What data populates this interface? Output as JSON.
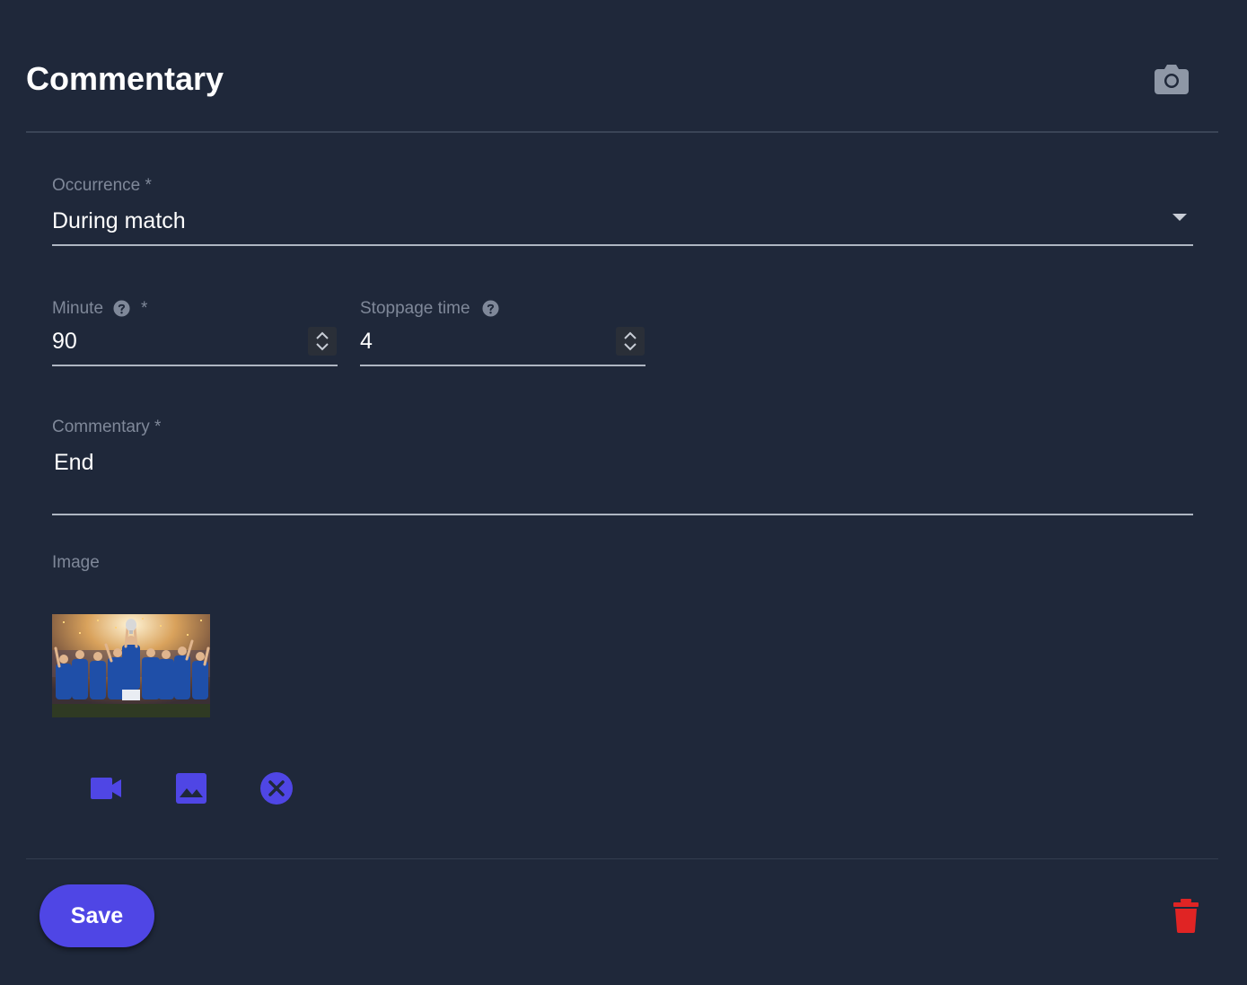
{
  "dialog": {
    "title": "Commentary",
    "camera_icon": "camera-icon"
  },
  "occurrence": {
    "label": "Occurrence *",
    "value": "During match",
    "caret_icon": "arrow-drop-down-icon"
  },
  "minute": {
    "label": "Minute",
    "required_mark": "*",
    "value": "90",
    "help_icon": "help-circle-icon"
  },
  "stoppage": {
    "label": "Stoppage time",
    "value": "4",
    "help_icon": "help-circle-icon"
  },
  "commentary": {
    "label": "Commentary *",
    "value": "End"
  },
  "image": {
    "label": "Image",
    "actions": [
      "video-camera-icon",
      "image-icon",
      "close-circle-icon"
    ]
  },
  "footer": {
    "save_label": "Save",
    "delete_icon": "trash-icon"
  },
  "colors": {
    "background": "#1f283a",
    "accent": "#4f46e5",
    "danger": "#e02424",
    "label": "#7f8899"
  }
}
